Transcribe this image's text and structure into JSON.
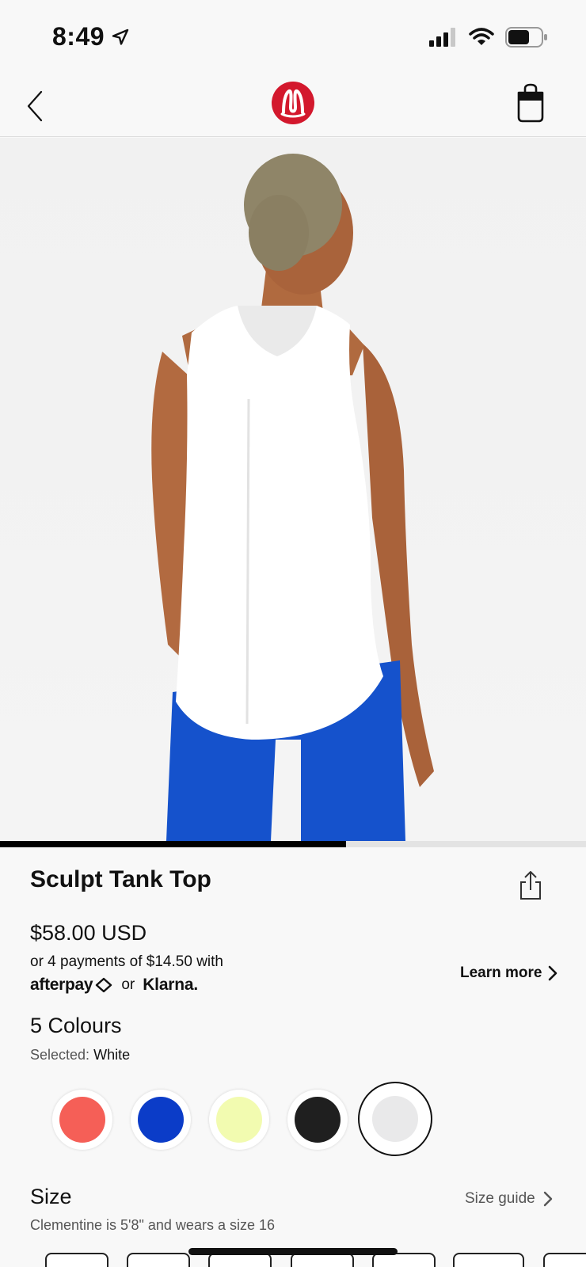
{
  "status_bar": {
    "time": "8:49",
    "battery_percent": 60
  },
  "nav": {
    "back_icon": "chevron-left-icon",
    "logo": "lululemon-logo",
    "bag_icon": "shopping-bag-icon"
  },
  "gallery": {
    "progress": 0.59,
    "image_description_icon": "product-photo"
  },
  "product": {
    "title": "Sculpt Tank Top",
    "price": "$58.00 USD",
    "installments": "or 4 payments of $14.50 with",
    "afterpay": "afterpay",
    "or_text": "or",
    "klarna": "Klarna.",
    "learn_more": "Learn more"
  },
  "colours": {
    "heading": "5 Colours",
    "selected_label": "Selected:",
    "selected_value": "White",
    "swatches": [
      {
        "name": "coral",
        "color": "#f55f57"
      },
      {
        "name": "blue",
        "color": "#0b3cc8"
      },
      {
        "name": "lime",
        "color": "#f2fbb0"
      },
      {
        "name": "black",
        "color": "#1f1f1f"
      },
      {
        "name": "white",
        "color": "#e9e9ea",
        "selected": true
      }
    ]
  },
  "size": {
    "heading": "Size",
    "guide_label": "Size guide",
    "fit_note": "Clementine is 5'8\" and wears a size 16"
  }
}
